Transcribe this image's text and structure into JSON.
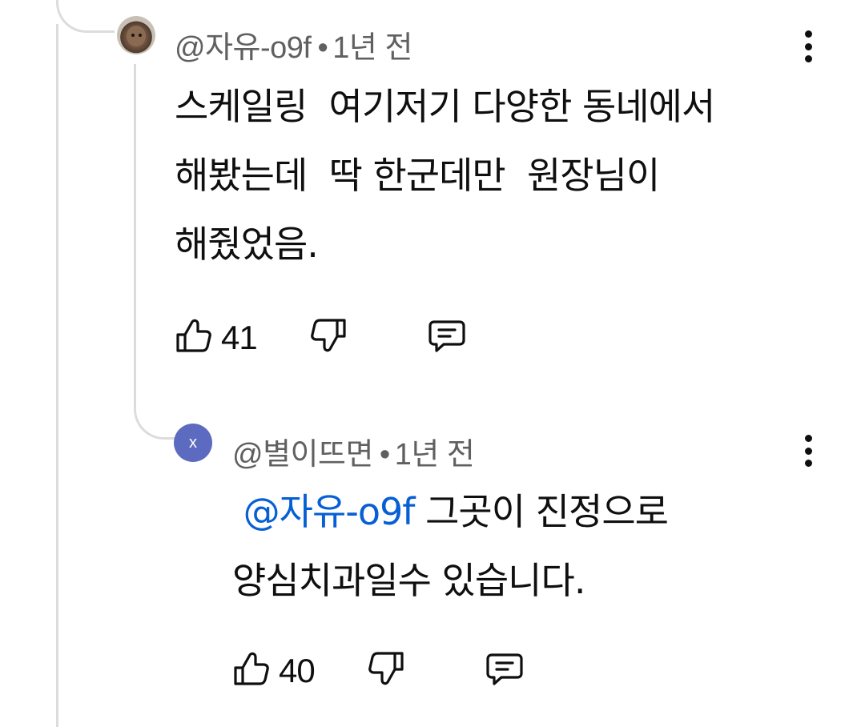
{
  "comment": {
    "author": "@자유-o9f",
    "separator": "•",
    "time": "1년 전",
    "lines": [
      "스케일링  여기저기 다양한 동네에서",
      "해봤는데  딱 한군데만  원장님이",
      "해줬었음."
    ],
    "likes": "41"
  },
  "reply": {
    "avatar_letter": "x",
    "avatar_color": "#5c6bc0",
    "author": "@별이뜨면",
    "separator": "•",
    "time": "1년 전",
    "mention": "@자유-o9f",
    "line1_rest": " 그곳이 진정으로",
    "line2": "양심치과일수 있습니다.",
    "likes": "40"
  },
  "icons": {
    "like": "thumbs-up-icon",
    "dislike": "thumbs-down-icon",
    "reply": "comment-icon",
    "more": "more-vertical-icon"
  },
  "colors": {
    "mention": "#065fd4",
    "meta_text": "#606060",
    "thread_line": "#dcdcdc"
  }
}
